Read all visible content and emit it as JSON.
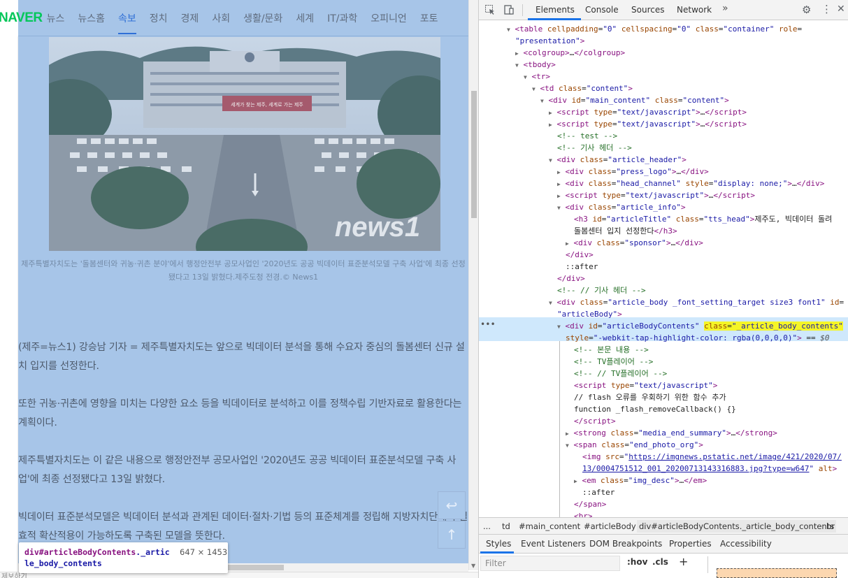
{
  "page": {
    "logo": "NAVER",
    "nav": [
      "뉴스",
      "뉴스홈",
      "속보",
      "정치",
      "경제",
      "사회",
      "생활/문화",
      "세계",
      "IT/과학",
      "오피니언",
      "포토"
    ],
    "active_nav": "속보",
    "photo_watermark": "news1",
    "photo_banner": "세계가 찾는 제주, 세계로 가는 제주",
    "caption": "제주특별자치도는 '돌봄센터와 귀농·귀촌 분야'에서 행정안전부 공모사업인 '2020년도 공공 빅데이터 표준분석모델 구축 사업'에 최종 선정됐다고 13일 밝혔다.제주도청 전경.© News1",
    "paragraphs": [
      "(제주=뉴스1) 강승남 기자 = 제주특별자치도는 앞으로 빅데이터 분석을 통해 수요자 중심의 돌봄센터 신규 설치 입지를 선정한다.",
      "또한 귀농·귀촌에 영향을 미치는 다양한 요소 등을 빅데이터로 분석하고 이를 정책수립 기반자료로 활용한다는 계획이다.",
      "제주특별자치도는 이 같은 내용으로 행정안전부 공모사업인 '2020년도 공공 빅데이터 표준분석모델 구축 사업'에 최종 선정됐다고 13일 밝혔다.",
      "빅데이터 표준분석모델은 빅데이터 분석과 관계된 데이터·절차·기법 등의 표준체계를 정립해 지방자치단체의 실효적 확산적용이 가능하도록 구축된 모델을 뜻한다."
    ],
    "bottom_text": "제보하기",
    "tooltip": {
      "selector_tag": "div",
      "selector_id": "#articleBodyContents",
      "selector_class": "._article_body_contents",
      "dimensions": "647 × 1453"
    }
  },
  "devtools": {
    "tabs": [
      "Elements",
      "Console",
      "Sources",
      "Network"
    ],
    "active_tab": "Elements",
    "more_tabs": "»",
    "dom_lines": [
      {
        "i": 0,
        "tri": "▼",
        "html": "<span class='tag'>&lt;table</span> <span class='attr'>cellpadding</span>=<span class='val'>\"0\"</span> <span class='attr'>cellspacing</span>=<span class='val'>\"0\"</span> <span class='attr'>class</span>=<span class='val'>\"container\"</span> <span class='attr'>role</span>="
      },
      {
        "i": 0,
        "tri": "",
        "html": "<span class='val'>\"presentation\"</span><span class='tag'>&gt;</span>"
      },
      {
        "i": 1,
        "tri": "▶",
        "html": "<span class='tag'>&lt;colgroup&gt;</span>…<span class='tag'>&lt;/colgroup&gt;</span>"
      },
      {
        "i": 1,
        "tri": "▼",
        "html": "<span class='tag'>&lt;tbody&gt;</span>"
      },
      {
        "i": 2,
        "tri": "▼",
        "html": "<span class='tag'>&lt;tr&gt;</span>"
      },
      {
        "i": 3,
        "tri": "▼",
        "html": "<span class='tag'>&lt;td</span> <span class='attr'>class</span>=<span class='val'>\"content\"</span><span class='tag'>&gt;</span>"
      },
      {
        "i": 4,
        "tri": "▼",
        "html": "<span class='tag'>&lt;div</span> <span class='attr'>id</span>=<span class='val'>\"main_content\"</span> <span class='attr'>class</span>=<span class='val'>\"content\"</span><span class='tag'>&gt;</span>"
      },
      {
        "i": 5,
        "tri": "▶",
        "html": "<span class='tag'>&lt;script</span> <span class='attr'>type</span>=<span class='val'>\"text/javascript\"</span><span class='tag'>&gt;</span>…<span class='tag'>&lt;/script&gt;</span>"
      },
      {
        "i": 5,
        "tri": "▶",
        "html": "<span class='tag'>&lt;script</span> <span class='attr'>type</span>=<span class='val'>\"text/javascript\"</span><span class='tag'>&gt;</span>…<span class='tag'>&lt;/script&gt;</span>"
      },
      {
        "i": 5,
        "tri": "",
        "html": "<span class='cmt'>&lt;!-- test --&gt;</span>"
      },
      {
        "i": 5,
        "tri": "",
        "html": "<span class='cmt'>&lt;!-- 기사 헤더 --&gt;</span>"
      },
      {
        "i": 5,
        "tri": "▼",
        "html": "<span class='tag'>&lt;div</span> <span class='attr'>class</span>=<span class='val'>\"article_header\"</span><span class='tag'>&gt;</span>"
      },
      {
        "i": 6,
        "tri": "▶",
        "html": "<span class='tag'>&lt;div</span> <span class='attr'>class</span>=<span class='val'>\"press_logo\"</span><span class='tag'>&gt;</span>…<span class='tag'>&lt;/div&gt;</span>"
      },
      {
        "i": 6,
        "tri": "▶",
        "html": "<span class='tag'>&lt;div</span> <span class='attr'>class</span>=<span class='val'>\"head_channel\"</span> <span class='attr'>style</span>=<span class='val'>\"display: none;\"</span><span class='tag'>&gt;</span>…<span class='tag'>&lt;/div&gt;</span>"
      },
      {
        "i": 6,
        "tri": "▶",
        "html": "<span class='tag'>&lt;script</span> <span class='attr'>type</span>=<span class='val'>\"text/javascript\"</span><span class='tag'>&gt;</span>…<span class='tag'>&lt;/script&gt;</span>"
      },
      {
        "i": 6,
        "tri": "▼",
        "html": "<span class='tag'>&lt;div</span> <span class='attr'>class</span>=<span class='val'>\"article_info\"</span><span class='tag'>&gt;</span>"
      },
      {
        "i": 7,
        "tri": "",
        "html": "<span class='tag'>&lt;h3</span> <span class='attr'>id</span>=<span class='val'>\"articleTitle\"</span> <span class='attr'>class</span>=<span class='val'>\"tts_head\"</span><span class='tag'>&gt;</span><span class='txt'>제주도, 빅데이터 돌려</span>"
      },
      {
        "i": 7,
        "tri": "",
        "html": "<span class='txt'>돌봄센터 입지 선정한다</span><span class='tag'>&lt;/h3&gt;</span>"
      },
      {
        "i": 7,
        "tri": "▶",
        "html": "<span class='tag'>&lt;div</span> <span class='attr'>class</span>=<span class='val'>\"sponsor\"</span><span class='tag'>&gt;</span>…<span class='tag'>&lt;/div&gt;</span>"
      },
      {
        "i": 6,
        "tri": "",
        "html": "<span class='tag'>&lt;/div&gt;</span>"
      },
      {
        "i": 6,
        "tri": "",
        "html": "<span class='txt'>::after</span>"
      },
      {
        "i": 5,
        "tri": "",
        "html": "<span class='tag'>&lt;/div&gt;</span>"
      },
      {
        "i": 5,
        "tri": "",
        "html": "<span class='cmt'>&lt;!-- // 기사 헤더 --&gt;</span>"
      },
      {
        "i": 5,
        "tri": "▼",
        "html": "<span class='tag'>&lt;div</span> <span class='attr'>class</span>=<span class='val'>\"article_body _font_setting_target size3 font1\"</span> <span class='attr'>id</span>="
      },
      {
        "i": 5,
        "tri": "",
        "html": "<span class='val'>\"articleBody\"</span><span class='tag'>&gt;</span>"
      },
      {
        "i": 6,
        "tri": "▼",
        "html": "<span class='tag'>&lt;div</span> <span class='attr'>id</span>=<span class='val'>\"articleBodyContents\"</span> <span class='yellow'><span class='attr'>class</span>=<span class='val'>\"_article_body_contents\"</span></span>"
      },
      {
        "i": 6,
        "tri": "",
        "html": "<span class='attr'>style</span>=<span class='val'>\"-webkit-tap-highlight-color: rgba(0,0,0,0)\"</span><span class='tag'>&gt;</span> == <span style='color:#555;font-style:italic'>$0</span>"
      },
      {
        "i": 7,
        "tri": "",
        "html": "<span class='cmt'>&lt;!-- 본문 내용 --&gt;</span>"
      },
      {
        "i": 7,
        "tri": "",
        "html": "<span class='cmt'>&lt;!-- TV플레이어 --&gt;</span>"
      },
      {
        "i": 7,
        "tri": "",
        "html": "<span class='cmt'>&lt;!-- // TV플레이어 --&gt;</span>"
      },
      {
        "i": 7,
        "tri": "",
        "html": "<span class='tag'>&lt;script</span> <span class='attr'>type</span>=<span class='val'>\"text/javascript\"</span><span class='tag'>&gt;</span>"
      },
      {
        "i": 7,
        "tri": "",
        "html": "<span class='txt'>// flash 오류를 우회하기 위한 함수 추가</span>"
      },
      {
        "i": 7,
        "tri": "",
        "html": "<span class='txt'>function _flash_removeCallback() {}</span>"
      },
      {
        "i": 7,
        "tri": "",
        "html": "<span class='tag'>&lt;/script&gt;</span>"
      },
      {
        "i": 7,
        "tri": "▶",
        "html": "<span class='tag'>&lt;strong</span> <span class='attr'>class</span>=<span class='val'>\"media_end_summary\"</span><span class='tag'>&gt;</span>…<span class='tag'>&lt;/strong&gt;</span>"
      },
      {
        "i": 7,
        "tri": "▼",
        "html": "<span class='tag'>&lt;span</span> <span class='attr'>class</span>=<span class='val'>\"end_photo_org\"</span><span class='tag'>&gt;</span>"
      },
      {
        "i": 8,
        "tri": "",
        "html": "<span class='tag'>&lt;img</span> <span class='attr'>src</span>=<span class='val'>\"</span><span class='link'>https://imgnews.pstatic.net/image/421/2020/07/</span>"
      },
      {
        "i": 8,
        "tri": "",
        "html": "<span class='link'>13/0004751512_001_20200713143316883.jpg?type=w647</span><span class='val'>\"</span> <span class='attr'>alt</span><span class='tag'>&gt;</span>"
      },
      {
        "i": 8,
        "tri": "▶",
        "html": "<span class='tag'>&lt;em</span> <span class='attr'>class</span>=<span class='val'>\"img_desc\"</span><span class='tag'>&gt;</span>…<span class='tag'>&lt;/em&gt;</span>"
      },
      {
        "i": 8,
        "tri": "",
        "html": "<span class='txt'>::after</span>"
      },
      {
        "i": 7,
        "tri": "",
        "html": "<span class='tag'>&lt;/span&gt;</span>"
      },
      {
        "i": 7,
        "tri": "",
        "html": "<span class='tag'>&lt;br&gt;</span>"
      }
    ],
    "dots": "•••",
    "breadcrumb": [
      "...",
      "td",
      "#main_content",
      "#articleBody",
      "div#articleBodyContents._article_body_contents",
      "br"
    ],
    "subtabs": [
      "Styles",
      "Event Listeners",
      "DOM Breakpoints",
      "Properties",
      "Accessibility"
    ],
    "filter_placeholder": "Filter",
    "hov": ":hov",
    "cls": ".cls",
    "plus": "+"
  }
}
